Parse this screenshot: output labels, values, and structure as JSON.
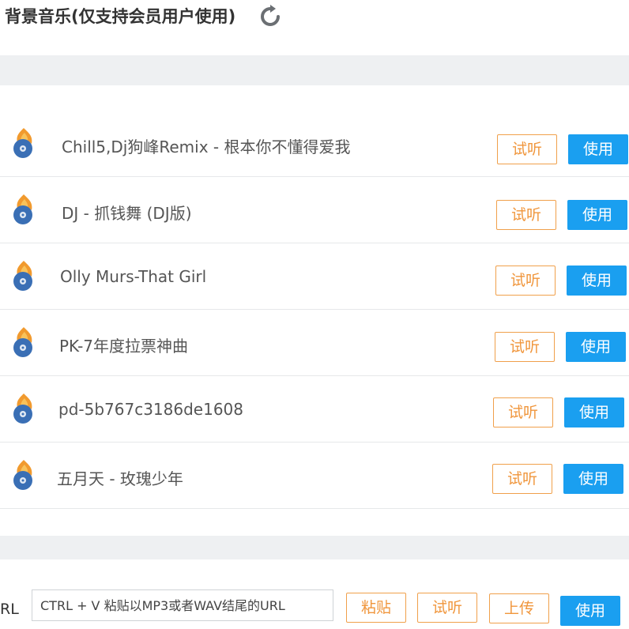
{
  "header": {
    "title": "背景音乐(仅支持会员用户使用)",
    "refresh_icon": "refresh-icon"
  },
  "songs": [
    {
      "name": "Chill5,Dj狗峰Remix - 根本你不懂得爱我",
      "preview_label": "试听",
      "use_label": "使用"
    },
    {
      "name": "DJ - 抓钱舞 (DJ版)",
      "preview_label": "试听",
      "use_label": "使用"
    },
    {
      "name": "Olly Murs-That Girl",
      "preview_label": "试听",
      "use_label": "使用"
    },
    {
      "name": "PK-7年度拉票神曲",
      "preview_label": "试听",
      "use_label": "使用"
    },
    {
      "name": "pd-5b767c3186de1608",
      "preview_label": "试听",
      "use_label": "使用"
    },
    {
      "name": "五月天 - 玫瑰少年",
      "preview_label": "试听",
      "use_label": "使用"
    }
  ],
  "url_bar": {
    "label": "RL",
    "placeholder": "CTRL + V 粘贴以MP3或者WAV结尾的URL",
    "paste_label": "粘贴",
    "preview_label": "试听",
    "upload_label": "上传",
    "use_label": "使用"
  },
  "colors": {
    "accent_blue": "#1a9ff0",
    "accent_orange": "#f0963c",
    "band_gray": "#eef0f2",
    "text": "#555555"
  }
}
